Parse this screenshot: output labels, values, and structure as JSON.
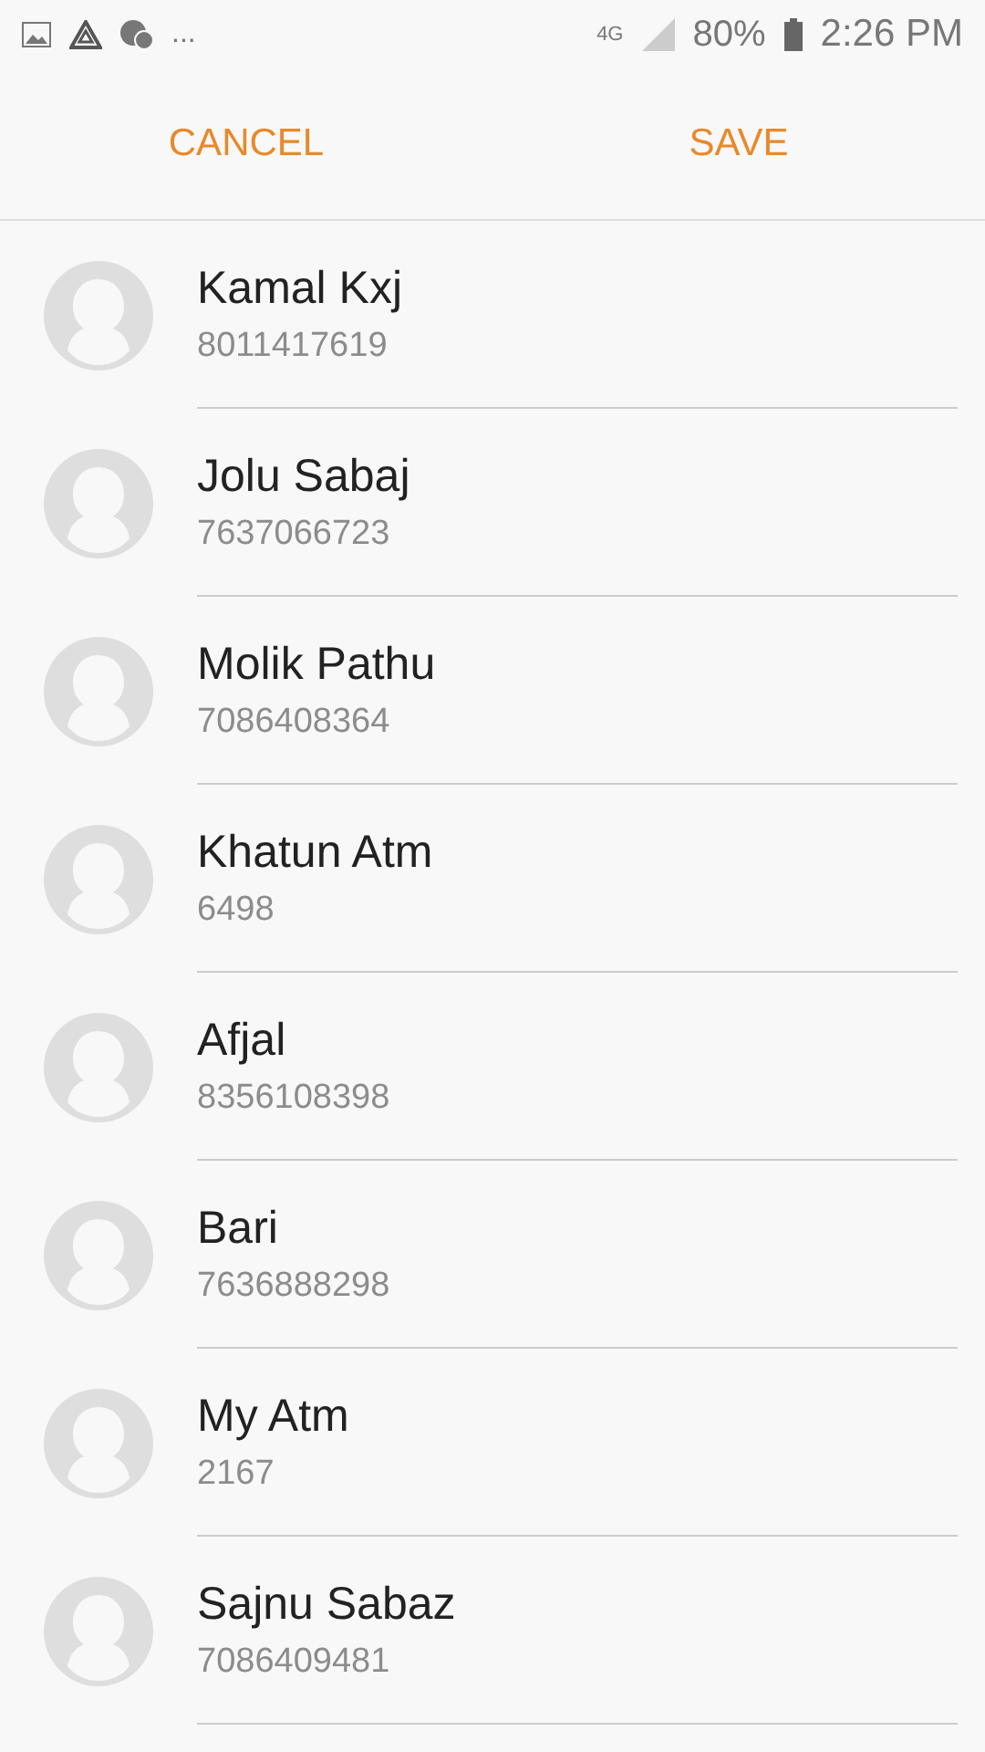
{
  "status_bar": {
    "more": "...",
    "network": "4G",
    "battery": "80%",
    "time": "2:26 PM"
  },
  "header": {
    "cancel": "CANCEL",
    "save": "SAVE"
  },
  "contacts": [
    {
      "name": "Kamal Kxj",
      "number": "8011417619"
    },
    {
      "name": "Jolu Sabaj",
      "number": "7637066723"
    },
    {
      "name": "Molik Pathu",
      "number": "7086408364"
    },
    {
      "name": "Khatun Atm",
      "number": "6498"
    },
    {
      "name": "Afjal",
      "number": "8356108398"
    },
    {
      "name": "Bari",
      "number": "7636888298"
    },
    {
      "name": "My Atm",
      "number": "2167"
    },
    {
      "name": "Sajnu Sabaz",
      "number": "7086409481"
    }
  ]
}
